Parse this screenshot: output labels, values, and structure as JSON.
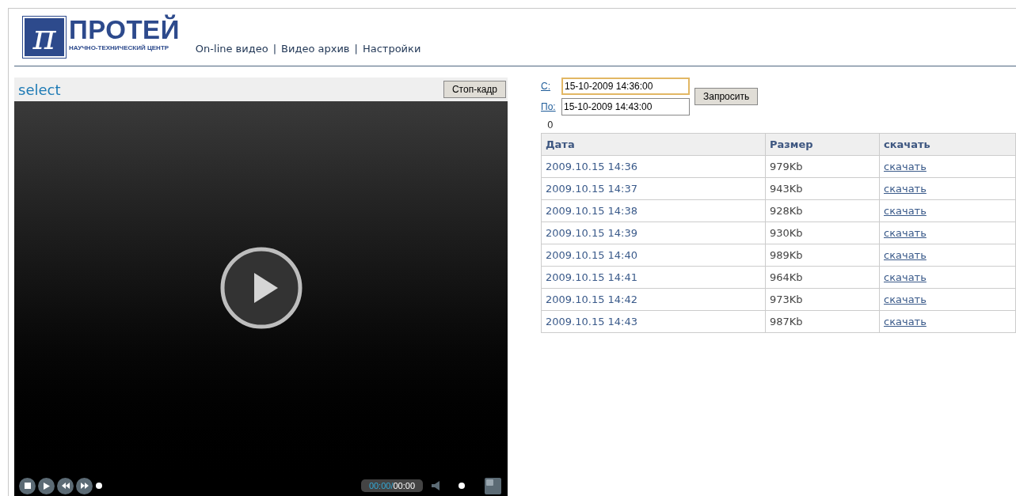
{
  "logo": {
    "mark": "π",
    "name": "ПРОТЕЙ",
    "subtitle": "НАУЧНО-ТЕХНИЧЕСКИЙ ЦЕНТР"
  },
  "nav": [
    {
      "label": "On-line видео"
    },
    {
      "label": "Видео архив"
    },
    {
      "label": "Настройки"
    }
  ],
  "nav_separator": "|",
  "player": {
    "title": "select",
    "snapshot_button": "Стоп-кадр",
    "time_current": "00:00/",
    "time_total": "00:00"
  },
  "query": {
    "from_label": "С:",
    "from_value": "15-10-2009 14:36:00",
    "from_focused": true,
    "to_label": "По:",
    "to_value": "15-10-2009 14:43:00",
    "to_focused": false,
    "submit": "Запросить",
    "count": "0"
  },
  "table": {
    "columns": [
      "Дата",
      "Размер",
      "скачать"
    ],
    "rows": [
      {
        "date": "2009.10.15 14:36",
        "size": "979Kb",
        "link": "скачать"
      },
      {
        "date": "2009.10.15 14:37",
        "size": "943Kb",
        "link": "скачать"
      },
      {
        "date": "2009.10.15 14:38",
        "size": "928Kb",
        "link": "скачать"
      },
      {
        "date": "2009.10.15 14:39",
        "size": "930Kb",
        "link": "скачать"
      },
      {
        "date": "2009.10.15 14:40",
        "size": "989Kb",
        "link": "скачать"
      },
      {
        "date": "2009.10.15 14:41",
        "size": "964Kb",
        "link": "скачать"
      },
      {
        "date": "2009.10.15 14:42",
        "size": "973Kb",
        "link": "скачать"
      },
      {
        "date": "2009.10.15 14:43",
        "size": "987Kb",
        "link": "скачать"
      }
    ]
  }
}
